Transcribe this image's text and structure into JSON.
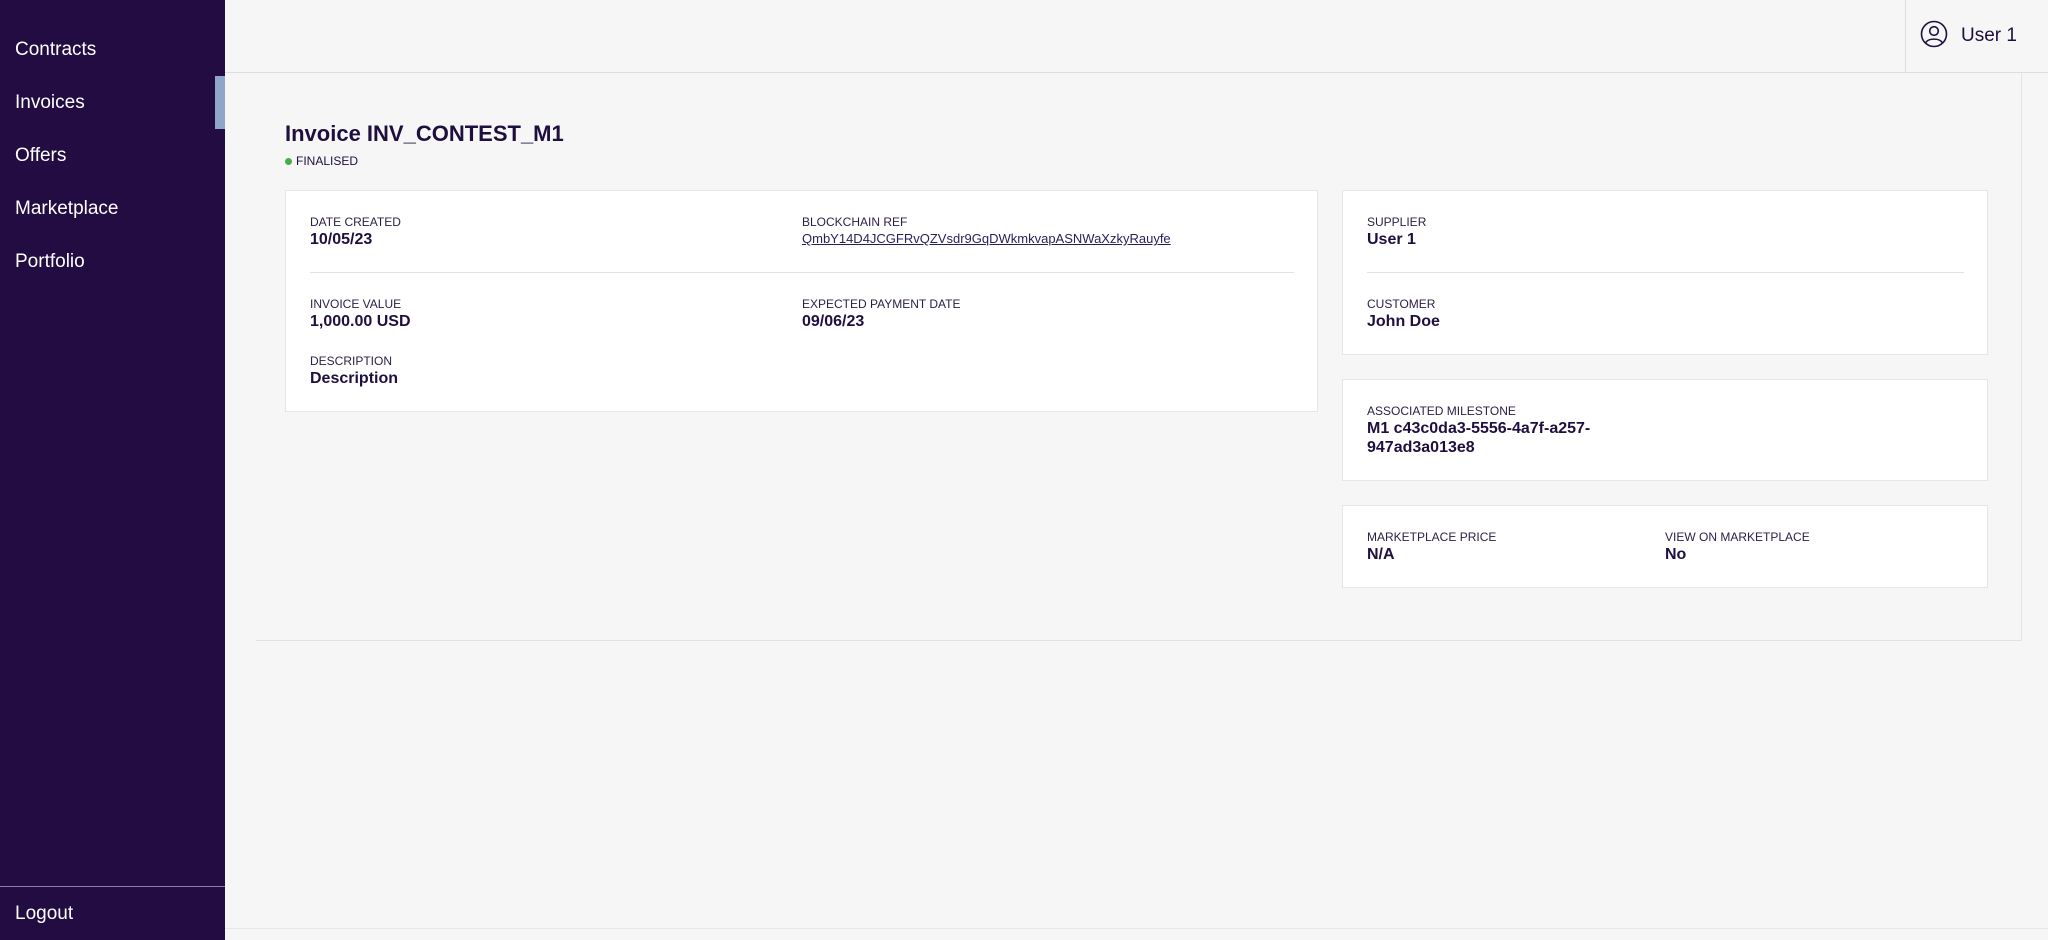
{
  "sidebar": {
    "items": [
      {
        "label": "Contracts"
      },
      {
        "label": "Invoices"
      },
      {
        "label": "Offers"
      },
      {
        "label": "Marketplace"
      },
      {
        "label": "Portfolio"
      }
    ],
    "logout_label": "Logout"
  },
  "header": {
    "user_name": "User 1"
  },
  "invoice": {
    "title": "Invoice INV_CONTEST_M1",
    "status": "FINALISED",
    "date_created_label": "DATE CREATED",
    "date_created": "10/05/23",
    "blockchain_ref_label": "BLOCKCHAIN REF",
    "blockchain_ref": "QmbY14D4JCGFRvQZVsdr9GqDWkmkvapASNWaXzkyRauyfe",
    "invoice_value_label": "INVOICE VALUE",
    "invoice_value": "1,000.00 USD",
    "expected_payment_label": "EXPECTED PAYMENT DATE",
    "expected_payment": "09/06/23",
    "description_label": "DESCRIPTION",
    "description": "Description"
  },
  "parties": {
    "supplier_label": "SUPPLIER",
    "supplier": "User 1",
    "customer_label": "CUSTOMER",
    "customer": "John Doe"
  },
  "milestone": {
    "label": "ASSOCIATED MILESTONE",
    "value_line1": "M1 c43c0da3-5556-4a7f-a257-",
    "value_line2": "947ad3a013e8"
  },
  "marketplace": {
    "price_label": "MARKETPLACE PRICE",
    "price": "N/A",
    "view_label": "VIEW ON MARKETPLACE",
    "view": "No"
  },
  "colors": {
    "sidebar_bg": "#220c42",
    "active_indicator": "#8fa6c8",
    "status_dot": "#45b04b",
    "text_primary": "#1f0f3f"
  }
}
